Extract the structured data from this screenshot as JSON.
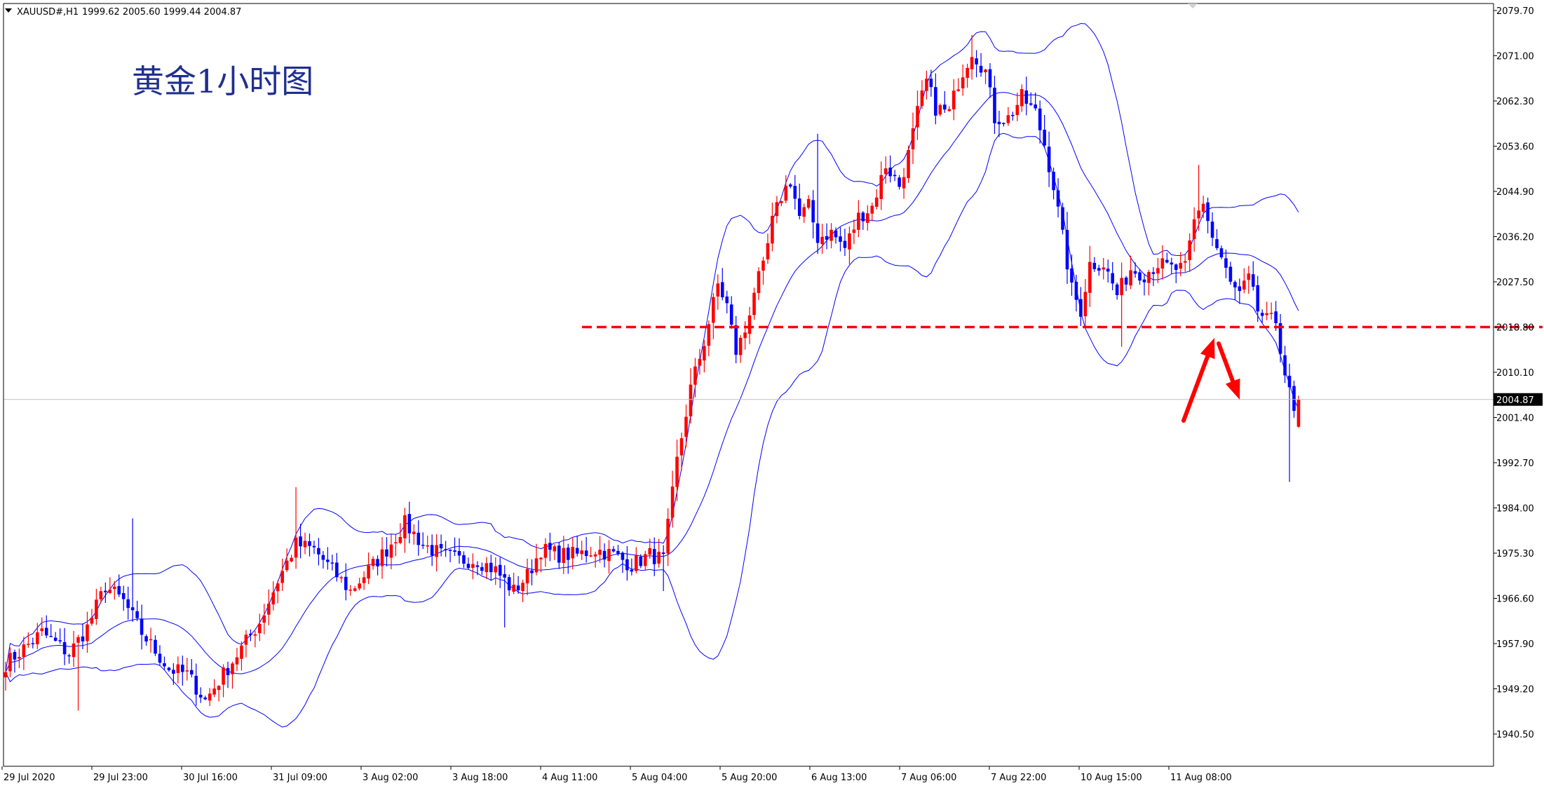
{
  "header": {
    "dropdown_icon": "triangle-down-icon",
    "symbol": "XAUUSD#,H1",
    "ohlc": "1999.62 2005.60 1999.44 2004.87"
  },
  "annotation_title": "黄金1小时图",
  "chart_data": {
    "type": "candlestick",
    "symbol": "XAUUSD#",
    "timeframe": "H1",
    "ylim": [
      1935.0,
      2084.0
    ],
    "y_ticks": [
      "2079.70",
      "2071.00",
      "2062.30",
      "2053.60",
      "2044.90",
      "2036.20",
      "2027.50",
      "2018.80",
      "2010.10",
      "2001.40",
      "1992.70",
      "1984.00",
      "1975.30",
      "1966.60",
      "1957.90",
      "1949.20",
      "1940.50"
    ],
    "x_ticks": [
      "29 Jul 2020",
      "29 Jul 23:00",
      "30 Jul 16:00",
      "31 Jul 09:00",
      "3 Aug 02:00",
      "3 Aug 18:00",
      "4 Aug 11:00",
      "5 Aug 04:00",
      "5 Aug 20:00",
      "6 Aug 13:00",
      "7 Aug 06:00",
      "7 Aug 22:00",
      "10 Aug 15:00",
      "11 Aug 08:00"
    ],
    "current_price": "2004.87",
    "current_price_value": 2004.87,
    "support_level": 2018.8,
    "bullish_color": "#ff0000",
    "bearish_color": "#0000ff",
    "band_color": "#0000ff",
    "annotation_arrow_color": "#ff0000"
  }
}
